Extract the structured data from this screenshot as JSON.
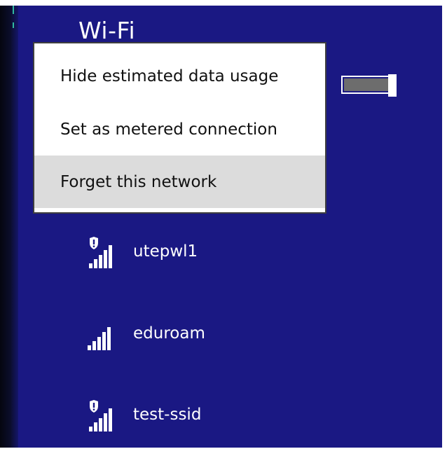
{
  "panel": {
    "title": "Wi-Fi",
    "wifi_toggle_on": true,
    "background_color": "#1a1883",
    "text_color": "#ffffff"
  },
  "context_menu": {
    "items": [
      {
        "label": "Hide estimated data usage",
        "highlighted": false
      },
      {
        "label": "Set as metered connection",
        "highlighted": false
      },
      {
        "label": "Forget this network",
        "highlighted": true
      }
    ],
    "highlight_color": "#dcdcdc"
  },
  "networks": [
    {
      "ssid": "utepwl1",
      "icon": "wifi-signal-secured-icon",
      "secured": true
    },
    {
      "ssid": "eduroam",
      "icon": "wifi-signal-icon",
      "secured": false
    },
    {
      "ssid": "test-ssid",
      "icon": "wifi-signal-secured-icon",
      "secured": true
    }
  ]
}
